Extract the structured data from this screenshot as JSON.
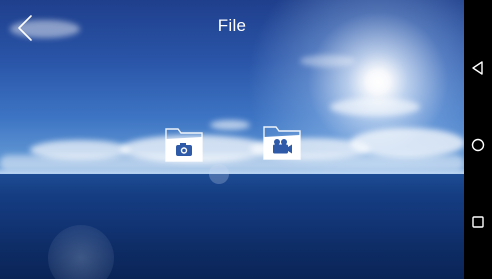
{
  "header": {
    "title": "File",
    "back_icon": "chevron-left-icon"
  },
  "folders": [
    {
      "icon": "photo-folder-icon",
      "glyph": "camera-icon"
    },
    {
      "icon": "video-folder-icon",
      "glyph": "video-camera-icon"
    }
  ],
  "navbar": {
    "back_icon": "nav-back-triangle-icon",
    "home_icon": "nav-home-circle-icon",
    "recents_icon": "nav-recents-square-icon"
  },
  "colors": {
    "sky_top": "#1f3f8c",
    "sea": "#123576",
    "icon_white": "#ffffff",
    "navbar": "#000000"
  }
}
